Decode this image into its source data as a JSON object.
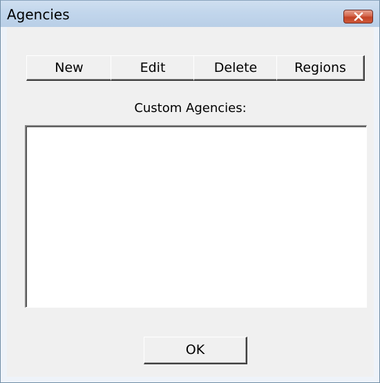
{
  "window": {
    "title": "Agencies"
  },
  "titlebar": {
    "close_icon": "close-icon"
  },
  "toolbar": {
    "new_label": "New",
    "edit_label": "Edit",
    "delete_label": "Delete",
    "regions_label": "Regions"
  },
  "list": {
    "label": "Custom Agencies:",
    "items": []
  },
  "footer": {
    "ok_label": "OK"
  }
}
